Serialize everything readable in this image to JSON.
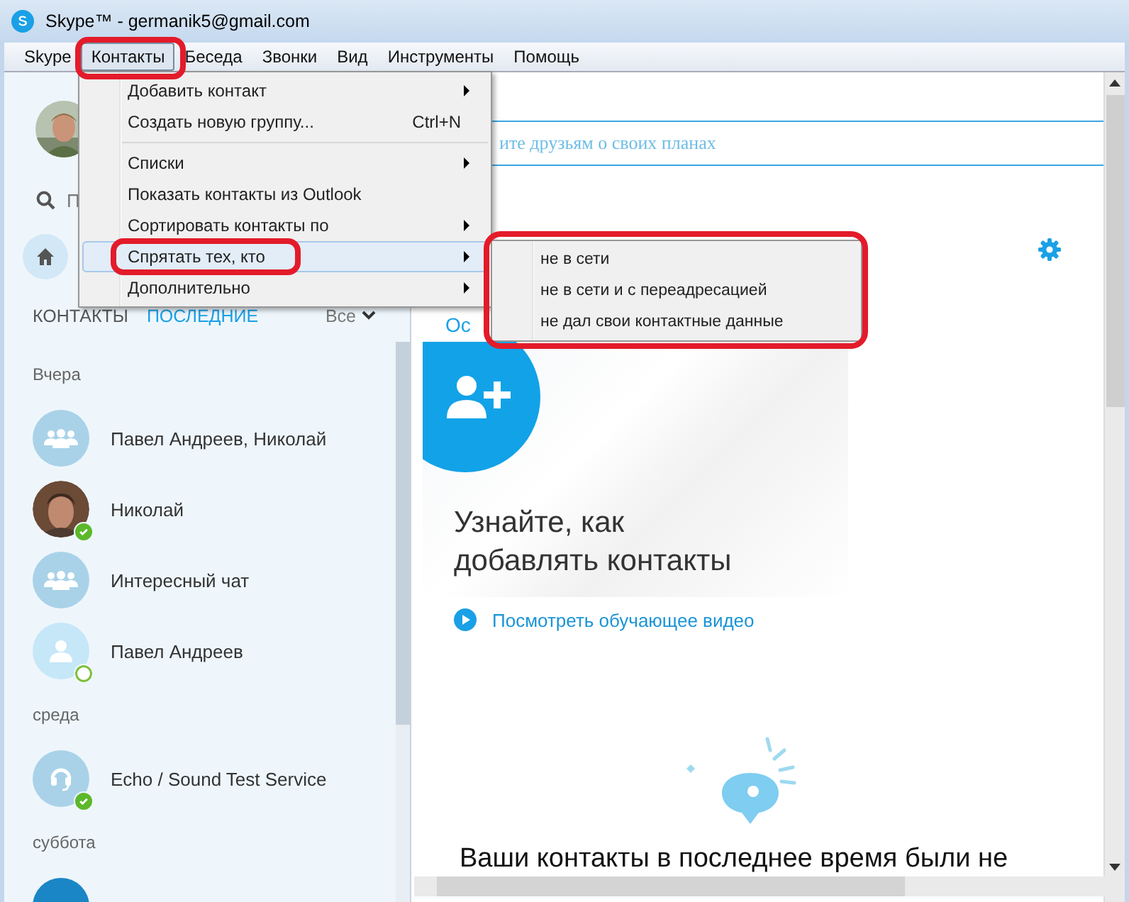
{
  "window": {
    "title": "Skype™ - germanik5@gmail.com"
  },
  "menu_bar": [
    {
      "label": "Skype",
      "selected": false
    },
    {
      "label": "Контакты",
      "selected": true,
      "annotated": true
    },
    {
      "label": "Беседа",
      "selected": false
    },
    {
      "label": "Звонки",
      "selected": false
    },
    {
      "label": "Вид",
      "selected": false
    },
    {
      "label": "Инструменты",
      "selected": false
    },
    {
      "label": "Помощь",
      "selected": false
    }
  ],
  "contacts_menu": [
    {
      "label": "Добавить контакт",
      "submenu": true,
      "highlighted": false
    },
    {
      "label": "Создать новую группу...",
      "shortcut": "Ctrl+N",
      "submenu": false,
      "highlighted": false
    },
    {
      "label": "Списки",
      "submenu": true,
      "highlighted": false,
      "separator_before": true
    },
    {
      "label": "Показать контакты из Outlook",
      "submenu": false,
      "highlighted": false
    },
    {
      "label": "Сортировать контакты по",
      "submenu": true,
      "highlighted": false
    },
    {
      "label": "Спрятать тех, кто",
      "submenu": true,
      "highlighted": true,
      "annotated": true
    },
    {
      "label": "Дополнительно",
      "submenu": true,
      "highlighted": false
    }
  ],
  "hide_submenu": {
    "annotated": true,
    "items": [
      "не в сети",
      "не в сети и с переадресацией",
      "не дал свои контактные данные"
    ]
  },
  "sidebar": {
    "search": {
      "placeholder": "П"
    },
    "tabs": [
      {
        "label": "КОНТАКТЫ",
        "selected": false
      },
      {
        "label": "ПОСЛЕДНИЕ",
        "selected": true
      }
    ],
    "filter": "Все",
    "groups": [
      {
        "heading": "Вчера",
        "items": [
          {
            "name": "Павел Андреев, Николай",
            "kind": "group"
          },
          {
            "name": "Николай",
            "online": true
          },
          {
            "name": "Интересный чат",
            "kind": "group"
          },
          {
            "name": "Павел Андреев",
            "kind": "person",
            "online": false
          }
        ]
      },
      {
        "heading": "среда",
        "items": [
          {
            "name": "Echo / Sound Test Service",
            "kind": "headset",
            "online": true
          }
        ]
      },
      {
        "heading": "суббота",
        "items": [
          {
            "kind": "blank"
          }
        ]
      }
    ]
  },
  "main": {
    "mood_text": "ите друзьям о своих планах",
    "tab_label": "Ос",
    "card": {
      "heading_lines": [
        "Узнайте, как",
        "добавлять контакты"
      ]
    },
    "video_link": "Посмотреть обучающее видео",
    "footer_text": "Ваши контакты в последнее время были не"
  }
}
